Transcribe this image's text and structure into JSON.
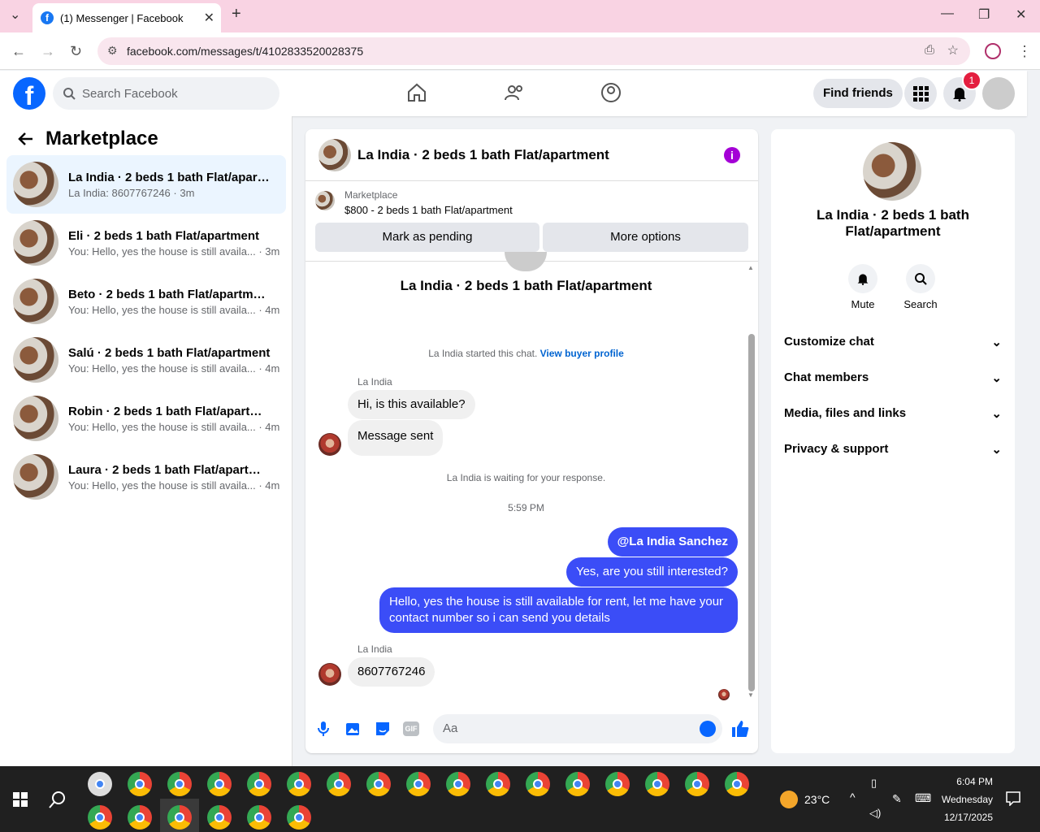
{
  "browser": {
    "tab_title": "(1) Messenger | Facebook",
    "url": "facebook.com/messages/t/4102833520028375"
  },
  "fb": {
    "search_placeholder": "Search Facebook",
    "find_friends": "Find friends",
    "notif_count": "1"
  },
  "left": {
    "title": "Marketplace",
    "conversations": [
      {
        "title": "La India · 2 beds 1 bath Flat/apart...",
        "sub": "La India: 8607767246 · 3m"
      },
      {
        "title": "Eli · 2 beds 1 bath Flat/apartment",
        "sub": "You: Hello, yes the house is still availa... · 3m"
      },
      {
        "title": "Beto · 2 beds 1 bath Flat/apartment",
        "sub": "You: Hello, yes the house is still availa... · 4m"
      },
      {
        "title": "Salú · 2 beds 1 bath Flat/apartment",
        "sub": "You: Hello, yes the house is still availa... · 4m"
      },
      {
        "title": "Robin · 2 beds 1 bath Flat/apartment",
        "sub": "You: Hello, yes the house is still availa... · 4m"
      },
      {
        "title": "Laura · 2 beds 1 bath Flat/apartment",
        "sub": "You: Hello, yes the house is still availa... · 4m"
      }
    ]
  },
  "chat": {
    "title": "La India · 2 beds 1 bath Flat/apartment",
    "marketplace_label": "Marketplace",
    "listing": "$800 - 2 beds 1 bath Flat/apartment",
    "mark_pending": "Mark as pending",
    "more_options": "More options",
    "header_name": "La India · 2 beds 1 bath Flat/apartment",
    "started_text": "La India started this chat.",
    "buyer_profile": "View buyer profile",
    "sender": "La India",
    "msg1": "Hi, is this available?",
    "msg2": "Message sent",
    "waiting": "La India is waiting for your response.",
    "time": "5:59 PM",
    "out1": "@La India Sanchez",
    "out2": "Yes, are you still interested?",
    "out3": "Hello, yes the house is still available for rent, let me have your contact number so i can send you details",
    "sender2": "La India",
    "msg3": "8607767246",
    "input_placeholder": "Aa"
  },
  "right": {
    "title": "La India · 2 beds 1 bath Flat/apartment",
    "mute": "Mute",
    "search": "Search",
    "sections": [
      "Customize chat",
      "Chat members",
      "Media, files and links",
      "Privacy & support"
    ]
  },
  "taskbar": {
    "weather": "23°C",
    "time": "6:04 PM",
    "day": "Wednesday",
    "date": "12/17/2025"
  },
  "colors": {
    "accent": "#0866ff",
    "bubble_out": "#3b4df7",
    "tab_bg": "#f9d3e3"
  }
}
